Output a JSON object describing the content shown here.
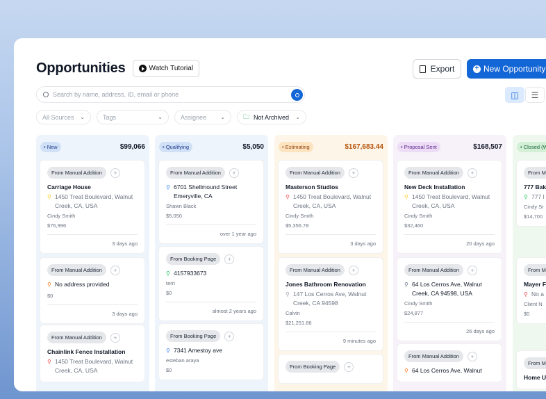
{
  "page": {
    "title": "Opportunities",
    "watch_tutorial": "Watch Tutorial"
  },
  "actions": {
    "export": "Export",
    "new_opportunity": "New Opportunity"
  },
  "search": {
    "placeholder": "Search by name, address, ID, email or phone"
  },
  "filters": [
    {
      "label": "All Sources"
    },
    {
      "label": "Tags"
    },
    {
      "label": "Assignee"
    },
    {
      "label": "Not Archived"
    }
  ],
  "view_toggle": {
    "active": "board"
  },
  "colors": {
    "primary": "#1366d6"
  },
  "columns": [
    {
      "status": "New",
      "amount": "$99,066",
      "cards": [
        {
          "source": "From Manual Addition",
          "title": "Carriage House",
          "address": "1450 Treat Boulevard, Walnut Creek, CA, USA",
          "contact": "Cindy Smith",
          "value": "$76,996",
          "time": "3 days ago"
        },
        {
          "source": "From Manual Addition",
          "title": "",
          "address": "No address provided",
          "contact": "",
          "value": "$0",
          "time": "3 days ago"
        },
        {
          "source": "From Manual Addition",
          "title": "Chainlink Fence Installation",
          "address": "1450 Treat Boulevard, Walnut Creek, CA, USA",
          "contact": "",
          "value": "",
          "time": ""
        }
      ]
    },
    {
      "status": "Qualifying",
      "amount": "$5,050",
      "cards": [
        {
          "source": "From Manual Addition",
          "title": "",
          "address": "6701 Shellmound Street Emeryville, CA",
          "contact": "Shawn Black",
          "value": "$5,050",
          "time": "over 1 year ago"
        },
        {
          "source": "From Booking Page",
          "title": "",
          "address": "4157933673",
          "contact": "terri",
          "value": "$0",
          "time": "almost 2 years ago"
        },
        {
          "source": "From Booking Page",
          "title": "",
          "address": "7341 Amestoy ave",
          "contact": "esteban araya",
          "value": "$0",
          "time": ""
        }
      ]
    },
    {
      "status": "Estimating",
      "amount": "$167,683.44",
      "cards": [
        {
          "source": "From Manual Addition",
          "title": "Masterson Studios",
          "address": "1450 Treat Boulevard, Walnut Creek, CA, USA",
          "contact": "Cindy Smith",
          "value": "$5,356.78",
          "time": "3 days ago"
        },
        {
          "source": "From Manual Addition",
          "title": "Jones Bathroom Renovation",
          "address": "147 Los Cerros Ave, Walnut Creek, CA 94598",
          "contact": "Calvin",
          "value": "$21,251.66",
          "time": "9 minutes ago"
        },
        {
          "source": "From Booking Page",
          "title": "",
          "address": "",
          "contact": "",
          "value": "",
          "time": ""
        }
      ]
    },
    {
      "status": "Proposal Sent",
      "amount": "$168,507",
      "cards": [
        {
          "source": "From Manual Addition",
          "title": "New Deck Installation",
          "address": "1450 Treat Boulevard, Walnut Creek, CA, USA",
          "contact": "Cindy Smith",
          "value": "$32,460",
          "time": "20 days ago"
        },
        {
          "source": "From Manual Addition",
          "title": "",
          "address": "64 Los Cerros Ave, Walnut Creek, CA 94598, USA",
          "contact": "Cindy Smith",
          "value": "$24,877",
          "time": "26 days ago"
        },
        {
          "source": "From Manual Addition",
          "title": "",
          "address": "64 Los Cerros Ave, Walnut",
          "contact": "",
          "value": "",
          "time": ""
        }
      ]
    },
    {
      "status": "Closed (W",
      "amount": "",
      "cards": [
        {
          "source": "From M",
          "title": "777 Bak",
          "address": "777 I Fran",
          "contact": "Cindy Sr",
          "value": "$14,700",
          "time": ""
        },
        {
          "source": "From M",
          "title": "Mayer F",
          "address": "No a",
          "contact": "Client N",
          "value": "$0",
          "time": ""
        },
        {
          "source": "From M",
          "title": "Home U",
          "address": "",
          "contact": "",
          "value": "",
          "time": ""
        }
      ]
    }
  ]
}
